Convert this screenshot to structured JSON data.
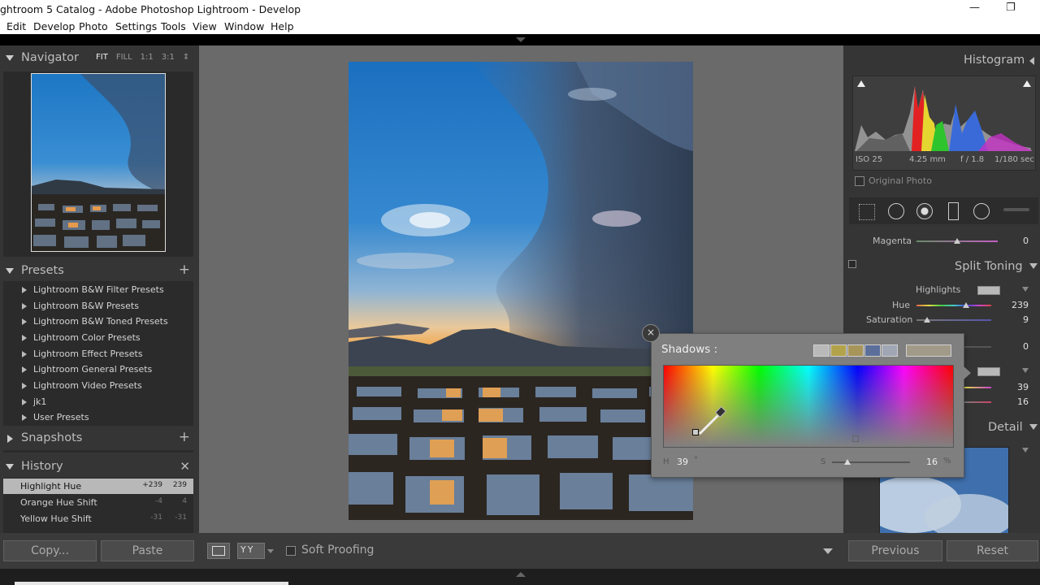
{
  "window": {
    "title": "ghtroom 5 Catalog - Adobe Photoshop Lightroom - Develop",
    "minimize": "—",
    "maximize": "❐"
  },
  "menu": [
    "Edit",
    "Develop",
    "Photo",
    "Settings",
    "Tools",
    "View",
    "Window",
    "Help"
  ],
  "navigator": {
    "title": "Navigator",
    "options": [
      "FIT",
      "FILL",
      "1:1",
      "3:1"
    ]
  },
  "presets": {
    "title": "Presets",
    "items": [
      "Lightroom B&W Filter Presets",
      "Lightroom B&W Presets",
      "Lightroom B&W Toned Presets",
      "Lightroom Color Presets",
      "Lightroom Effect Presets",
      "Lightroom General Presets",
      "Lightroom Video Presets",
      "jk1",
      "User Presets"
    ]
  },
  "snapshots": {
    "title": "Snapshots"
  },
  "history": {
    "title": "History",
    "items": [
      {
        "label": "Highlight Hue",
        "delta": "+239",
        "value": "239"
      },
      {
        "label": "Orange Hue Shift",
        "delta": "-4",
        "value": "4"
      },
      {
        "label": "Yellow Hue Shift",
        "delta": "-31",
        "value": "-31"
      }
    ]
  },
  "left_buttons": {
    "copy": "Copy...",
    "paste": "Paste"
  },
  "toolbar": {
    "soft_proofing": "Soft Proofing"
  },
  "histogram": {
    "title": "Histogram",
    "iso": "ISO 25",
    "focal": "4.25 mm",
    "aperture": "f / 1.8",
    "shutter": "1/180 sec",
    "original_photo": "Original Photo"
  },
  "magenta": {
    "label": "Magenta",
    "value": "0",
    "fraction": 0.5
  },
  "split_toning": {
    "title": "Split Toning",
    "highlights_label": "Highlights",
    "hue_label": "Hue",
    "hue_value": "239",
    "hue_fraction": 0.66,
    "saturation_label": "Saturation",
    "saturation_value": "9",
    "saturation_fraction": 0.09,
    "balance_value": "0",
    "shadow_hue_value": "39",
    "shadow_sat_value": "16"
  },
  "detail": {
    "title": "Detail"
  },
  "right_buttons": {
    "previous": "Previous",
    "reset": "Reset"
  },
  "shadows_popup": {
    "title": "Shadows :",
    "h_label": "H",
    "h_value": "39",
    "h_unit": "°",
    "s_label": "S",
    "s_value": "16",
    "s_unit": "%",
    "s_fraction": 0.16,
    "swatches": [
      "#b9b9b9",
      "#b2a24a",
      "#a8955a",
      "#5c6f9a",
      "#a0a6b4"
    ],
    "current_color": "#a29a88",
    "close": "×"
  }
}
